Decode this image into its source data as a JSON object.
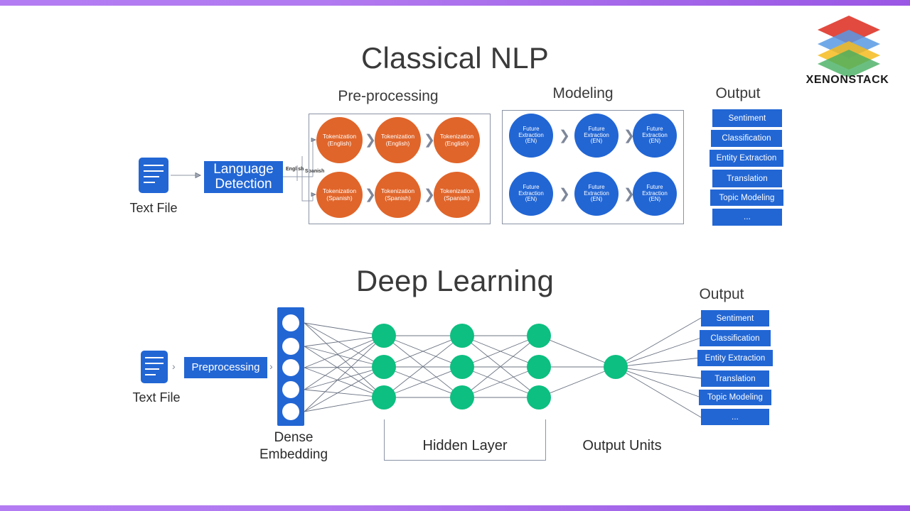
{
  "brand": {
    "name": "XENONSTACK",
    "logo_colors": [
      "#e03b2f",
      "#4a90e2",
      "#f5b50a",
      "#34a853"
    ]
  },
  "theme": {
    "accent_purple": "#a964ea",
    "blue": "#2266d4",
    "orange": "#e0652a",
    "green": "#0dbf81",
    "frame_gray": "#8a93a5",
    "text_dark": "#3a3a3a"
  },
  "classical": {
    "title": "Classical NLP",
    "input": {
      "label": "Text File"
    },
    "language_detection": {
      "line1": "Language",
      "line2": "Detection"
    },
    "branch_labels": {
      "english": "English",
      "spanish": "Spanish"
    },
    "preprocessing": {
      "title": "Pre-processing",
      "rows": [
        {
          "lang": "English",
          "steps": [
            {
              "line1": "Tokenization",
              "line2": "(English)"
            },
            {
              "line1": "Tokenization",
              "line2": "(English)"
            },
            {
              "line1": "Tokenization",
              "line2": "(English)"
            }
          ]
        },
        {
          "lang": "Spanish",
          "steps": [
            {
              "line1": "Tokenization",
              "line2": "(Spanish)"
            },
            {
              "line1": "Tokenization",
              "line2": "(Spanish)"
            },
            {
              "line1": "Tokenization",
              "line2": "(Spanish)"
            }
          ]
        }
      ]
    },
    "modeling": {
      "title": "Modeling",
      "rows": [
        {
          "steps": [
            {
              "line1": "Future",
              "line2": "Extraction",
              "line3": "(EN)"
            },
            {
              "line1": "Future",
              "line2": "Extraction",
              "line3": "(EN)"
            },
            {
              "line1": "Future",
              "line2": "Extraction",
              "line3": "(EN)"
            }
          ]
        },
        {
          "steps": [
            {
              "line1": "Future",
              "line2": "Extraction",
              "line3": "(EN)"
            },
            {
              "line1": "Future",
              "line2": "Extraction",
              "line3": "(EN)"
            },
            {
              "line1": "Future",
              "line2": "Extraction",
              "line3": "(EN)"
            }
          ]
        }
      ]
    },
    "output": {
      "title": "Output",
      "items": [
        "Sentiment",
        "Classification",
        "Entity Extraction",
        "Translation",
        "Topic Modeling",
        "..."
      ]
    }
  },
  "deep_learning": {
    "title": "Deep Learning",
    "input": {
      "label": "Text File"
    },
    "preprocessing_button": "Preprocessing",
    "dense_embedding": {
      "line1": "Dense",
      "line2": "Embedding",
      "units": 5
    },
    "hidden_layer": {
      "label": "Hidden Layer",
      "layers": 3,
      "nodes_per_layer": 3
    },
    "output_units": {
      "label": "Output Units",
      "count": 1
    },
    "output": {
      "title": "Output",
      "items": [
        "Sentiment",
        "Classification",
        "Entity Extraction",
        "Translation",
        "Topic Modeling",
        "..."
      ]
    }
  },
  "chevrons": {
    "glyph": "›",
    "big_glyph": "❯"
  }
}
